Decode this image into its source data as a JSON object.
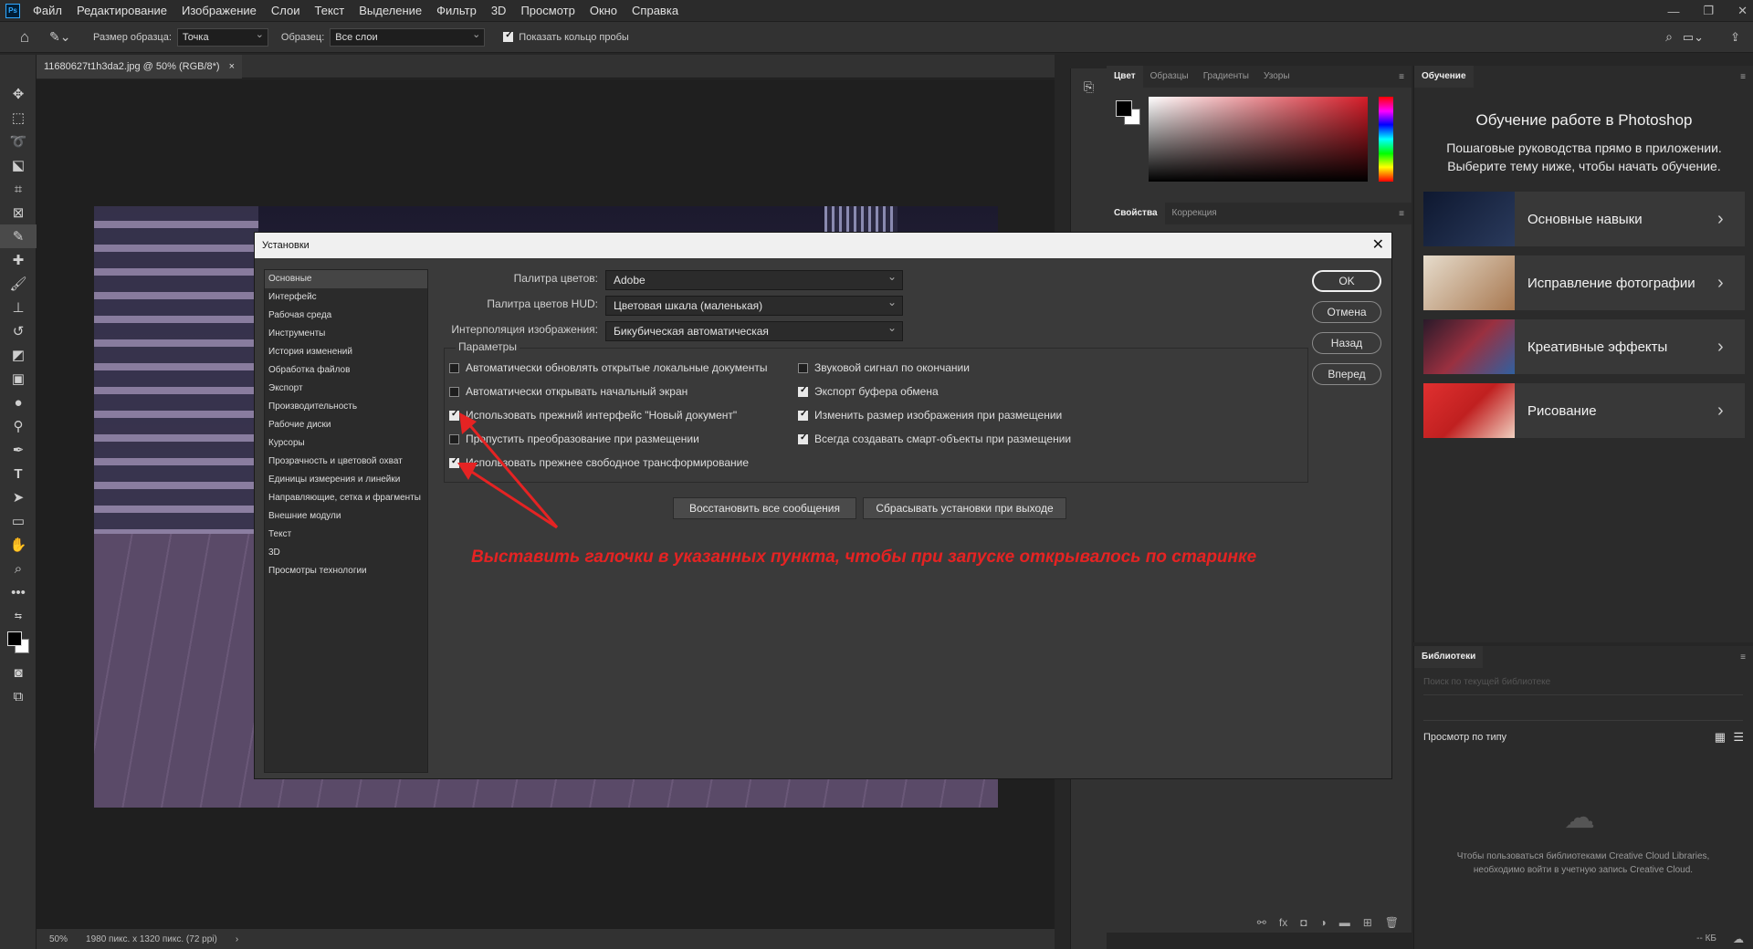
{
  "app": {
    "logo": "Ps"
  },
  "menu": [
    "Файл",
    "Редактирование",
    "Изображение",
    "Слои",
    "Текст",
    "Выделение",
    "Фильтр",
    "3D",
    "Просмотр",
    "Окно",
    "Справка"
  ],
  "window_controls": {
    "minimize": "—",
    "restore": "❐",
    "close": "✕"
  },
  "options_bar": {
    "sample_size_label": "Размер образца:",
    "sample_size_value": "Точка",
    "sample_label": "Образец:",
    "sample_value": "Все слои",
    "show_ring_label": "Показать кольцо пробы",
    "show_ring_checked": true
  },
  "document": {
    "tab_title": "11680627t1h3da2.jpg @ 50% (RGB/8*)",
    "close": "×"
  },
  "status": {
    "zoom": "50%",
    "info": "1980 пикс. x 1320 пикс. (72 ppi)",
    "arrow": "›"
  },
  "color_panel": {
    "tabs": [
      "Цвет",
      "Образцы",
      "Градиенты",
      "Узоры"
    ],
    "active": 0,
    "fg": "#000000",
    "bg": "#ffffff"
  },
  "properties_panel": {
    "tabs": [
      "Свойства",
      "Коррекция"
    ],
    "active": 0
  },
  "learn_panel": {
    "tab": "Обучение",
    "title": "Обучение работе в Photoshop",
    "subtitle": "Пошаговые руководства прямо в приложении. Выберите тему ниже, чтобы начать обучение.",
    "cards": [
      {
        "label": "Основные навыки",
        "thumb": "#1d2a44"
      },
      {
        "label": "Исправление фотографии",
        "thumb": "#c8b090"
      },
      {
        "label": "Креативные эффекты",
        "thumb": "#5a2a3a"
      },
      {
        "label": "Рисование",
        "thumb": "#d43030"
      }
    ]
  },
  "libraries_panel": {
    "tab": "Библиотеки",
    "search_placeholder": "Поиск по текущей библиотеке",
    "view_label": "Просмотр по типу",
    "message": "Чтобы пользоваться библиотеками Creative Cloud Libraries, необходимо войти в учетную запись Creative Cloud.",
    "size": "-- КБ"
  },
  "dialog": {
    "title": "Установки",
    "nav": [
      "Основные",
      "Интерфейс",
      "Рабочая среда",
      "Инструменты",
      "История изменений",
      "Обработка файлов",
      "Экспорт",
      "Производительность",
      "Рабочие диски",
      "Курсоры",
      "Прозрачность и цветовой охват",
      "Единицы измерения и линейки",
      "Направляющие, сетка и фрагменты",
      "Внешние модули",
      "Текст",
      "3D",
      "Просмотры технологии"
    ],
    "selected_nav": 0,
    "fields": [
      {
        "label": "Палитра цветов:",
        "value": "Adobe"
      },
      {
        "label": "Палитра цветов HUD:",
        "value": "Цветовая шкала (маленькая)"
      },
      {
        "label": "Интерполяция изображения:",
        "value": "Бикубическая автоматическая"
      }
    ],
    "group_label": "Параметры",
    "options_left": [
      {
        "label": "Автоматически обновлять открытые локальные документы",
        "checked": false
      },
      {
        "label": "Автоматически открывать начальный экран",
        "checked": false
      },
      {
        "label": "Использовать прежний интерфейс \"Новый документ\"",
        "checked": true
      },
      {
        "label": "Пропустить преобразование при размещении",
        "checked": false
      },
      {
        "label": "Использовать прежнее свободное трансформирование",
        "checked": true
      }
    ],
    "options_right": [
      {
        "label": "Звуковой сигнал по окончании",
        "checked": false
      },
      {
        "label": "Экспорт буфера обмена",
        "checked": true
      },
      {
        "label": "Изменить размер изображения при размещении",
        "checked": true
      },
      {
        "label": "Всегда создавать смарт-объекты при размещении",
        "checked": true
      }
    ],
    "restore_messages": "Восстановить все сообщения",
    "reset_on_quit": "Сбрасывать установки при выходе",
    "buttons": {
      "ok": "OK",
      "cancel": "Отмена",
      "back": "Назад",
      "next": "Вперед"
    }
  },
  "annotation": {
    "text": "Выставить галочки в указанных пункта, чтобы при запуске открывалось по старинке",
    "color": "#e52323"
  }
}
